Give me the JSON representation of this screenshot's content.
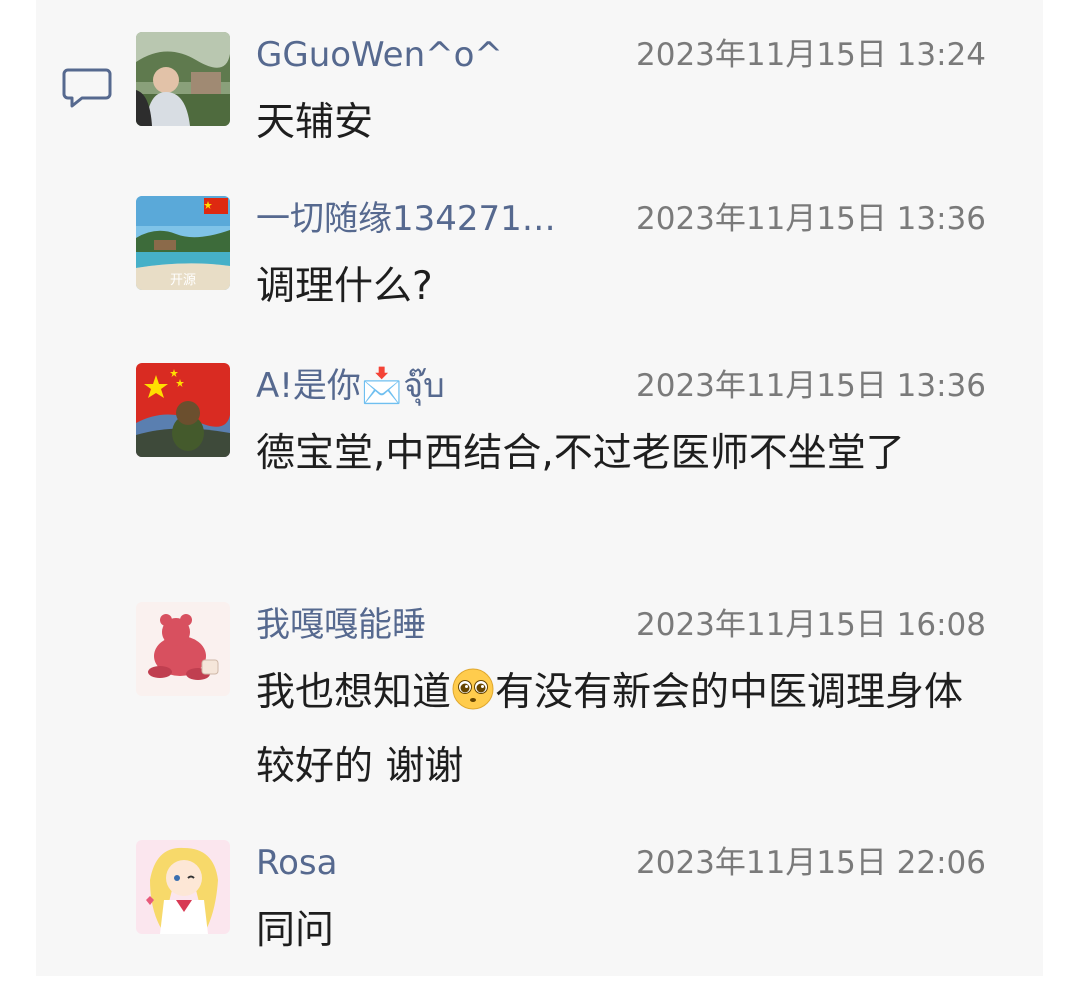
{
  "comments": [
    {
      "name": "GGuoWen^o^",
      "time": "2023年11月15日 13:24",
      "text": "天辅安",
      "avatar": "avatar-child-outdoor"
    },
    {
      "name": "一切随缘134271…",
      "time": "2023年11月15日 13:36",
      "text": "调理什么?",
      "avatar": "avatar-beach",
      "avatar_label": "开源"
    },
    {
      "name": "A!是你📩จุ๊บ",
      "time": "2023年11月15日 13:36",
      "text": "德宝堂,中西结合,不过老医师不坐堂了",
      "avatar": "avatar-flag-bear"
    },
    {
      "name": "我嘎嘎能睡",
      "time": "2023年11月15日 16:08",
      "text_before": "我也想知道",
      "text_emoji": "pleading-face",
      "text_after": "有没有新会的中医调理身体较好的 谢谢",
      "avatar": "avatar-pink-bear"
    },
    {
      "name": "Rosa",
      "time": "2023年11月15日 22:06",
      "text": "同问",
      "avatar": "avatar-sailor-moon"
    }
  ],
  "colors": {
    "name": "#56698f",
    "time": "#7a7a7a",
    "text": "#1e1e1e",
    "panel": "#f7f7f7"
  }
}
